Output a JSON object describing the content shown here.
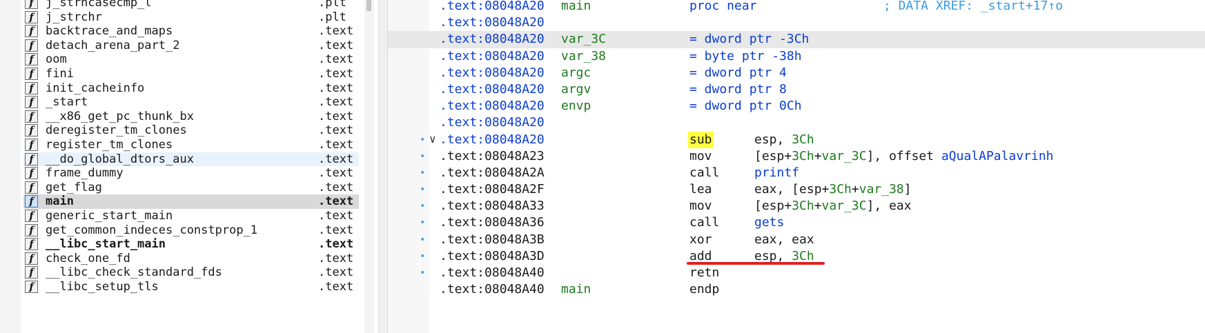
{
  "functions": [
    {
      "name": "j_strncasecmp_l",
      "segment": ".plt",
      "style": ""
    },
    {
      "name": "j_strchr",
      "segment": ".plt",
      "style": ""
    },
    {
      "name": "backtrace_and_maps",
      "segment": ".text",
      "style": ""
    },
    {
      "name": "detach_arena_part_2",
      "segment": ".text",
      "style": ""
    },
    {
      "name": "oom",
      "segment": ".text",
      "style": ""
    },
    {
      "name": "fini",
      "segment": ".text",
      "style": ""
    },
    {
      "name": "init_cacheinfo",
      "segment": ".text",
      "style": ""
    },
    {
      "name": "_start",
      "segment": ".text",
      "style": ""
    },
    {
      "name": "__x86_get_pc_thunk_bx",
      "segment": ".text",
      "style": ""
    },
    {
      "name": "deregister_tm_clones",
      "segment": ".text",
      "style": ""
    },
    {
      "name": "register_tm_clones",
      "segment": ".text",
      "style": ""
    },
    {
      "name": "__do_global_dtors_aux",
      "segment": ".text",
      "style": "hl"
    },
    {
      "name": "frame_dummy",
      "segment": ".text",
      "style": ""
    },
    {
      "name": "get_flag",
      "segment": ".text",
      "style": ""
    },
    {
      "name": "main",
      "segment": ".text",
      "style": "sel bold"
    },
    {
      "name": "generic_start_main",
      "segment": ".text",
      "style": ""
    },
    {
      "name": "get_common_indeces_constprop_1",
      "segment": ".text",
      "style": ""
    },
    {
      "name": "__libc_start_main",
      "segment": ".text",
      "style": "bold"
    },
    {
      "name": "check_one_fd",
      "segment": ".text",
      "style": ""
    },
    {
      "name": "__libc_check_standard_fds",
      "segment": ".text",
      "style": ""
    },
    {
      "name": "__libc_setup_tls",
      "segment": ".text",
      "style": ""
    }
  ],
  "function_icon_glyph": "f",
  "disasm": [
    {
      "addr": ".text:08048A20",
      "addr_blue": true,
      "label": "main",
      "mn": "proc near",
      "mn_blue": true,
      "ops": [],
      "comment": "; DATA XREF: _start+17↑o"
    },
    {
      "addr": ".text:08048A20",
      "addr_blue": true,
      "label": "",
      "mn": "",
      "ops": []
    },
    {
      "addr": ".text:08048A20",
      "addr_blue": true,
      "label": "var_3C",
      "mn": "= dword ptr -3Ch",
      "mn_blue": true,
      "ops": [],
      "current": true
    },
    {
      "addr": ".text:08048A20",
      "addr_blue": true,
      "label": "var_38",
      "mn": "= byte ptr -38h",
      "mn_blue": true,
      "ops": []
    },
    {
      "addr": ".text:08048A20",
      "addr_blue": true,
      "label": "argc",
      "mn": "= dword ptr  4",
      "mn_blue": true,
      "ops": []
    },
    {
      "addr": ".text:08048A20",
      "addr_blue": true,
      "label": "argv",
      "mn": "= dword ptr  8",
      "mn_blue": true,
      "ops": []
    },
    {
      "addr": ".text:08048A20",
      "addr_blue": true,
      "label": "envp",
      "mn": "= dword ptr  0Ch",
      "mn_blue": true,
      "ops": []
    },
    {
      "addr": ".text:08048A20",
      "addr_blue": true,
      "label": "",
      "mn": "",
      "ops": []
    },
    {
      "addr": ".text:08048A20",
      "addr_blue": true,
      "label": "",
      "mn": "sub",
      "mark": true,
      "ops": [
        {
          "t": "esp, "
        },
        {
          "t": "3Ch",
          "g": true
        }
      ],
      "dot": true,
      "arrow": "∨"
    },
    {
      "addr": ".text:08048A23",
      "label": "",
      "mn": "mov",
      "ops": [
        {
          "t": "[esp+"
        },
        {
          "t": "3Ch",
          "g": true
        },
        {
          "t": "+"
        },
        {
          "t": "var_3C",
          "g": true
        },
        {
          "t": "], offset "
        },
        {
          "t": "aQualAPalavrinh",
          "blue": true
        }
      ],
      "dot": true
    },
    {
      "addr": ".text:08048A2A",
      "label": "",
      "mn": "call",
      "ops": [
        {
          "t": "printf",
          "blue": true
        }
      ],
      "dot": true
    },
    {
      "addr": ".text:08048A2F",
      "label": "",
      "mn": "lea",
      "ops": [
        {
          "t": "eax, [esp+"
        },
        {
          "t": "3Ch",
          "g": true
        },
        {
          "t": "+"
        },
        {
          "t": "var_38",
          "g": true
        },
        {
          "t": "]"
        }
      ],
      "dot": true
    },
    {
      "addr": ".text:08048A33",
      "label": "",
      "mn": "mov",
      "ops": [
        {
          "t": "[esp+"
        },
        {
          "t": "3Ch",
          "g": true
        },
        {
          "t": "+"
        },
        {
          "t": "var_3C",
          "g": true
        },
        {
          "t": "], eax"
        }
      ],
      "dot": true
    },
    {
      "addr": ".text:08048A36",
      "label": "",
      "mn": "call",
      "ops": [
        {
          "t": "gets",
          "blue": true
        }
      ],
      "dot": true
    },
    {
      "addr": ".text:08048A3B",
      "label": "",
      "mn": "xor",
      "ops": [
        {
          "t": "eax, eax"
        }
      ],
      "dot": true
    },
    {
      "addr": ".text:08048A3D",
      "label": "",
      "mn": "add",
      "ops": [
        {
          "t": "esp, "
        },
        {
          "t": "3Ch",
          "g": true
        }
      ],
      "dot": true
    },
    {
      "addr": ".text:08048A40",
      "label": "",
      "mn": "retn",
      "ops": [],
      "dot": true
    },
    {
      "addr": ".text:08048A40",
      "label": "main",
      "mn": "endp",
      "ops": []
    }
  ]
}
